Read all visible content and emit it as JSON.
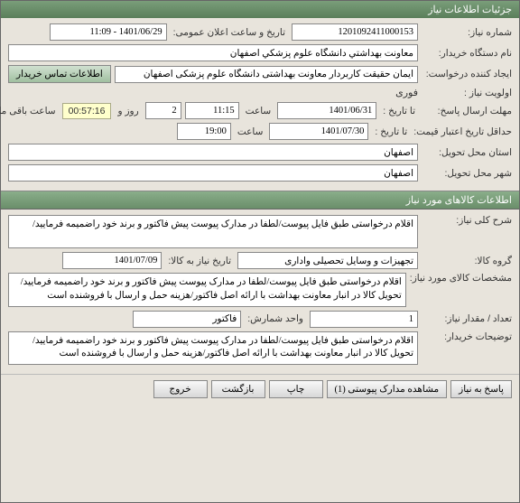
{
  "window": {
    "title": "جزئیات اطلاعات نیاز"
  },
  "top": {
    "need_no_label": "شماره نیاز:",
    "need_no": "1201092411000153",
    "announce_label": "تاریخ و ساعت اعلان عمومی:",
    "announce": "1401/06/29 - 11:09",
    "buyer_label": "نام دستگاه خریدار:",
    "buyer": "معاونت بهداشتي دانشگاه علوم پزشكي اصفهان",
    "creator_label": "ایجاد کننده درخواست:",
    "creator": "ایمان حقیقت کاربردار معاونت بهداشتی دانشگاه علوم پزشکی اصفهان",
    "contact_btn": "اطلاعات تماس خریدار",
    "priority_label": "اولویت نیاز :",
    "priority": "فوری",
    "deadline_label": "مهلت ارسال پاسخ:",
    "to_date_label": "تا تاریخ :",
    "deadline_date": "1401/06/31",
    "time_label": "ساعت",
    "deadline_time": "11:15",
    "days_remaining": "2",
    "days_and": "روز و",
    "countdown": "00:57:16",
    "remaining_text": "ساعت باقی مانده",
    "price_validity_label": "حداقل تاریخ اعتبار قیمت:",
    "price_date": "1401/07/30",
    "price_time": "19:00",
    "province_label": "استان محل تحویل:",
    "province": "اصفهان",
    "city_label": "شهر محل تحویل:",
    "city": "اصفهان"
  },
  "goods_header": "اطلاعات کالاهای مورد نیاز",
  "goods": {
    "need_desc_label": "شرح کلی نیاز:",
    "need_desc": "اقلام درخواستی طبق فایل پیوست/لطفا در مدارک پیوست پیش فاکتور و برند خود راضمیمه فرمایید/",
    "group_label": "گروه کالا:",
    "group": "تجهیزات و وسایل تحصیلی واداری",
    "need_by_label": "تاریخ نیاز به کالا:",
    "need_by": "1401/07/09",
    "spec_label": "مشخصات کالای مورد نیاز:",
    "spec": "اقلام درخواستی طبق فایل پیوست/لطفا در مدارک پیوست پیش فاکتور و برند خود راضمیمه فرمایید/تحویل کالا در انبار معاونت بهداشت با ارائه اصل فاکتور/هزینه حمل و ارسال با فروشنده است",
    "qty_label": "تعداد / مقدار نیاز:",
    "qty": "1",
    "unit_label": "واحد شمارش:",
    "unit": "فاکتور",
    "buyer_notes_label": "توضیحات خریدار:",
    "buyer_notes": "اقلام درخواستی طبق فایل پیوست/لطفا در مدارک پیوست پیش فاکتور و برند خود راضمیمه فرمایید/تحویل کالا در انبار معاونت بهداشت با ارائه اصل فاکتور/هزینه حمل و ارسال با فروشنده است"
  },
  "footer": {
    "reply": "پاسخ به نیاز",
    "attachments": "مشاهده مدارک پیوستی (1)",
    "print": "چاپ",
    "back": "بازگشت",
    "exit": "خروج"
  }
}
